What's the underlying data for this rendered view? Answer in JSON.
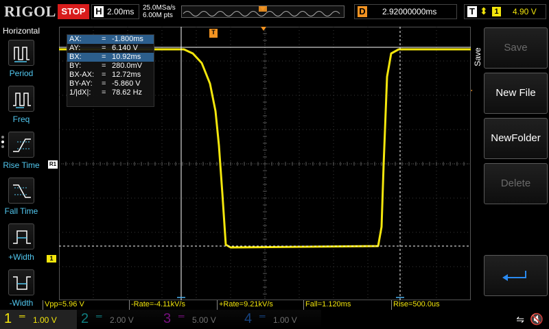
{
  "brand": "RIGOL",
  "run_status": "STOP",
  "horizontal": {
    "letter": "H",
    "scale": "2.00ms",
    "sample_rate": "25.0MSa/s",
    "memory_depth": "6.00M pts"
  },
  "delay": {
    "letter": "D",
    "value": "2.92000000ms"
  },
  "trigger": {
    "letter": "T",
    "slope_symbol": "⬍",
    "source": "1",
    "level": "4.90 V"
  },
  "left_menu": {
    "title": "Horizontal",
    "items": [
      {
        "label": "Period",
        "icon": "period-icon"
      },
      {
        "label": "Freq",
        "icon": "freq-icon"
      },
      {
        "label": "Rise Time",
        "icon": "rise-time-icon"
      },
      {
        "label": "Fall Time",
        "icon": "fall-time-icon"
      },
      {
        "label": "+Width",
        "icon": "pos-width-icon"
      },
      {
        "label": "-Width",
        "icon": "neg-width-icon"
      }
    ]
  },
  "cursor": {
    "rows": [
      {
        "name": "AX:",
        "eq": "=",
        "value": "-1.800ms",
        "highlight": true
      },
      {
        "name": "AY:",
        "eq": "=",
        "value": "6.140 V",
        "highlight": false
      },
      {
        "name": "BX:",
        "eq": "=",
        "value": "10.92ms",
        "highlight": true
      },
      {
        "name": "BY:",
        "eq": "=",
        "value": "280.0mV",
        "highlight": false
      },
      {
        "name": "BX-AX:",
        "eq": "=",
        "value": "12.72ms",
        "highlight": false
      },
      {
        "name": "BY-AY:",
        "eq": "=",
        "value": "-5.860 V",
        "highlight": false
      },
      {
        "name": "1/|dX|:",
        "eq": "=",
        "value": "78.62 Hz",
        "highlight": false
      }
    ]
  },
  "markers": {
    "ref": "R1",
    "channel1": "1",
    "trigger_pos": "T"
  },
  "right_menu": {
    "title": "Save",
    "buttons": [
      {
        "label": "Save",
        "enabled": false
      },
      {
        "label": "New File",
        "enabled": true
      },
      {
        "label": "NewFolder",
        "enabled": true
      },
      {
        "label": "Delete",
        "enabled": false
      },
      {
        "label": "",
        "enabled": true,
        "icon": "return-icon"
      }
    ]
  },
  "measurements": [
    {
      "label": "Vpp=5.96 V"
    },
    {
      "label": "-Rate=-4.11kV/s"
    },
    {
      "label": "+Rate=9.21kV/s"
    },
    {
      "label": "Fall=1.120ms"
    },
    {
      "label": "Rise=500.0us"
    }
  ],
  "channels": [
    {
      "num": "1",
      "coupling": "═",
      "scale": "1.00 V",
      "color": "#f3e60c",
      "active": true
    },
    {
      "num": "2",
      "coupling": "═",
      "scale": "2.00 V",
      "color": "#1ee4e8",
      "active": false
    },
    {
      "num": "3",
      "coupling": "═",
      "scale": "5.00 V",
      "color": "#d51ee4",
      "active": false
    },
    {
      "num": "4",
      "coupling": "═",
      "scale": "1.00 V",
      "color": "#2a7ae8",
      "active": false
    }
  ],
  "colors": {
    "ch1": "#f3e60c",
    "accent_orange": "#f29322",
    "stop_red": "#d81c1c",
    "menu_label": "#52c8f0"
  }
}
